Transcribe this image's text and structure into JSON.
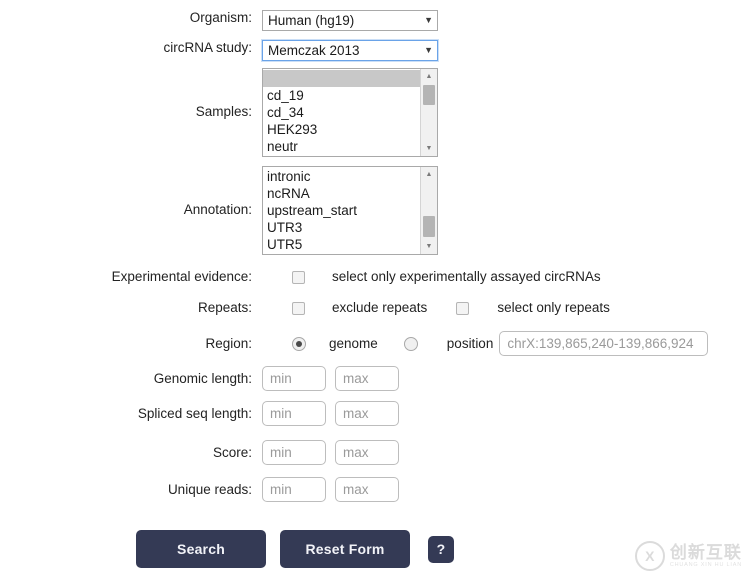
{
  "form": {
    "organism": {
      "label": "Organism:",
      "value": "Human (hg19)",
      "caret": "chevron-down-icon",
      "focused": false
    },
    "study": {
      "label": "circRNA study:",
      "value": "Memczak 2013",
      "caret": "chevron-down-icon",
      "focused": true
    },
    "samples": {
      "label": "Samples:",
      "options": [
        "",
        "cd_19",
        "cd_34",
        "HEK293",
        "neutr"
      ],
      "selected_index": 0,
      "scroll": {
        "up": "▲",
        "down": "▼",
        "thumb_top_pct": 0,
        "thumb_height_pct": 22
      }
    },
    "annotation": {
      "label": "Annotation:",
      "options": [
        "intronic",
        "ncRNA",
        "upstream_start",
        "UTR3",
        "UTR5"
      ],
      "selected_index": -1,
      "scroll": {
        "up": "▲",
        "down": "▼",
        "thumb_top_pct": 64,
        "thumb_height_pct": 24
      }
    },
    "experimental_evidence": {
      "label": "Experimental evidence:",
      "checkbox_label": "select only experimentally assayed circRNAs",
      "checked": false
    },
    "repeats": {
      "label": "Repeats:",
      "exclude_label": "exclude repeats",
      "exclude_checked": false,
      "only_label": "select only repeats",
      "only_checked": false
    },
    "region": {
      "label": "Region:",
      "genome_label": "genome",
      "genome_selected": true,
      "position_label": "position",
      "position_selected": false,
      "position_value": "",
      "position_placeholder": "chrX:139,865,240-139,866,924"
    },
    "genomic_length": {
      "label": "Genomic length:",
      "min_value": "",
      "min_placeholder": "min",
      "max_value": "",
      "max_placeholder": "max"
    },
    "spliced_seq_length": {
      "label": "Spliced seq length:",
      "min_value": "",
      "min_placeholder": "min",
      "max_value": "",
      "max_placeholder": "max"
    },
    "score": {
      "label": "Score:",
      "min_value": "",
      "min_placeholder": "min",
      "max_value": "",
      "max_placeholder": "max"
    },
    "unique_reads": {
      "label": "Unique reads:",
      "min_value": "",
      "min_placeholder": "min",
      "max_value": "",
      "max_placeholder": "max"
    },
    "actions": {
      "search_label": "Search",
      "reset_label": "Reset Form",
      "help_label": "?",
      "button_color": "#343a55",
      "button_text_color": "#f2f3f8"
    }
  },
  "watermark": {
    "mark": "X",
    "chinese": "创新互联",
    "pinyin": "CHUANG XIN HU LIAN",
    "color": "#b0b0b0"
  }
}
